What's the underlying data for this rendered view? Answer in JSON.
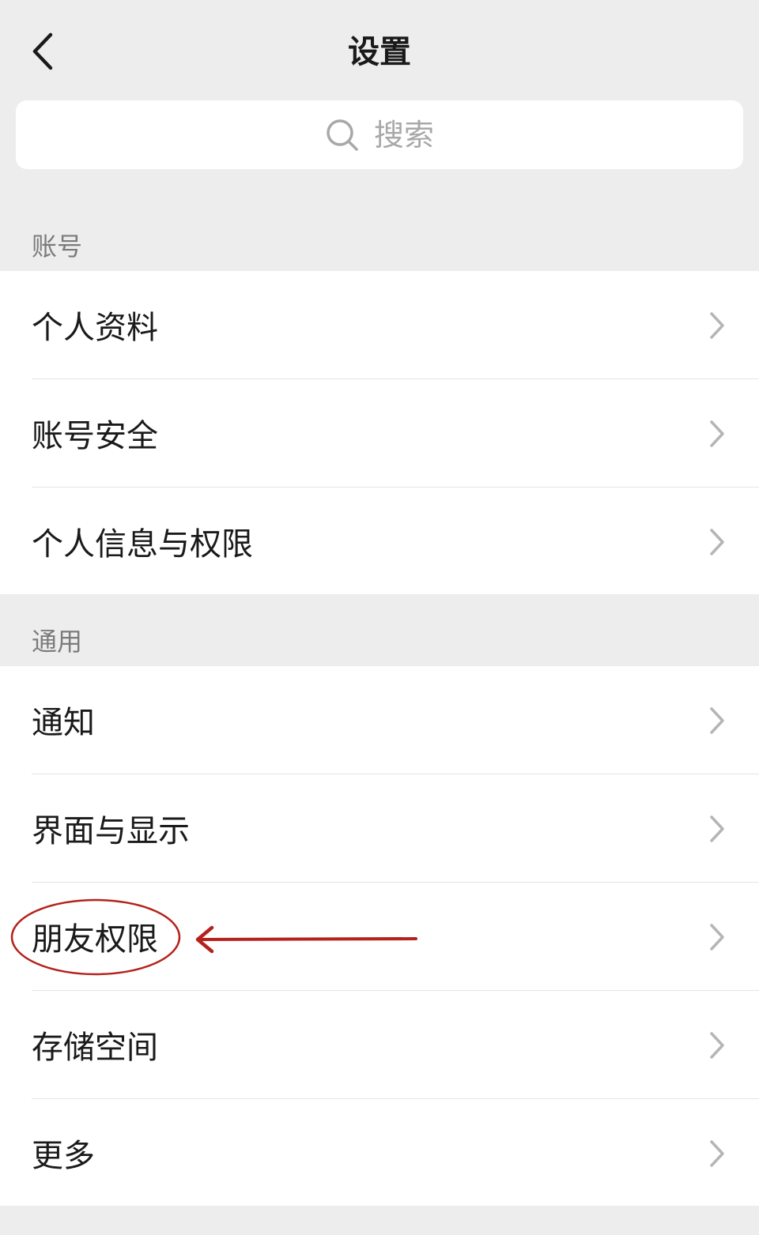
{
  "header": {
    "title": "设置",
    "back_icon": "chevron-left-icon"
  },
  "search": {
    "icon": "search-icon",
    "placeholder": "搜索"
  },
  "sections": [
    {
      "label": "账号",
      "items": [
        {
          "label": "个人资料"
        },
        {
          "label": "账号安全"
        },
        {
          "label": "个人信息与权限"
        }
      ]
    },
    {
      "label": "通用",
      "items": [
        {
          "label": "通知"
        },
        {
          "label": "界面与显示"
        },
        {
          "label": "朋友权限"
        },
        {
          "label": "存储空间"
        },
        {
          "label": "更多"
        }
      ]
    }
  ],
  "annotation": {
    "highlighted_item": "朋友权限",
    "color": "#b4221c"
  },
  "colors": {
    "background": "#ededed",
    "card": "#ffffff",
    "text": "#1a1a1a",
    "secondary_text": "#7b7b7b",
    "chevron": "#b5b5b5"
  }
}
